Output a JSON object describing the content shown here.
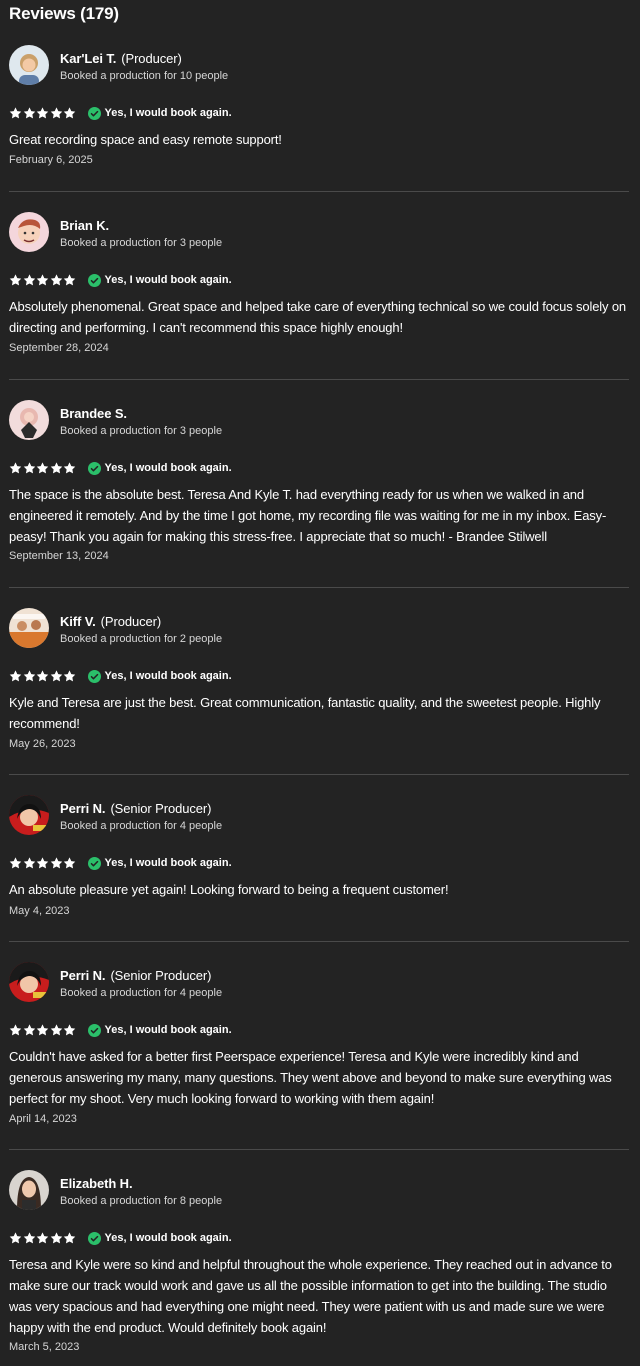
{
  "header": {
    "title": "Reviews (179)"
  },
  "icons": {
    "star": "star-icon",
    "check": "check-circle-icon"
  },
  "colors": {
    "background": "#232323",
    "check_green": "#2bbf6a",
    "star": "#ffffff"
  },
  "reviews": [
    {
      "name": "Kar'Lei T.",
      "role": "(Producer)",
      "booked": "Booked a production for 10 people",
      "rating": 5,
      "book_again": "Yes, I would book again.",
      "text": "Great recording space and easy remote support!",
      "date": "February 6, 2025"
    },
    {
      "name": "Brian K.",
      "role": "",
      "booked": "Booked a production for 3 people",
      "rating": 5,
      "book_again": "Yes, I would book again.",
      "text": "Absolutely phenomenal. Great space and helped take care of everything technical so we could focus solely on directing and performing. I can't recommend this space highly enough!",
      "date": "September 28, 2024"
    },
    {
      "name": "Brandee S.",
      "role": "",
      "booked": "Booked a production for 3 people",
      "rating": 5,
      "book_again": "Yes, I would book again.",
      "text": "The space is the absolute best. Teresa And Kyle T. had everything ready for us when we walked in and engineered it remotely. And by the time I got home, my recording file was waiting for me in my inbox. Easy-peasy! Thank you again for making this stress-free. I appreciate that so much! - Brandee Stilwell",
      "date": "September 13, 2024"
    },
    {
      "name": "Kiff V.",
      "role": "(Producer)",
      "booked": "Booked a production for 2 people",
      "rating": 5,
      "book_again": "Yes, I would book again.",
      "text": "Kyle and Teresa are just the best. Great communication, fantastic quality, and the sweetest people. Highly recommend!",
      "date": "May 26, 2023"
    },
    {
      "name": "Perri N.",
      "role": "(Senior Producer)",
      "booked": "Booked a production for 4 people",
      "rating": 5,
      "book_again": "Yes, I would book again.",
      "text": "An absolute pleasure yet again! Looking forward to being a frequent customer!",
      "date": "May 4, 2023"
    },
    {
      "name": "Perri N.",
      "role": "(Senior Producer)",
      "booked": "Booked a production for 4 people",
      "rating": 5,
      "book_again": "Yes, I would book again.",
      "text": "Couldn't have asked for a better first Peerspace experience! Teresa and Kyle were incredibly kind and generous answering my many, many questions. They went above and beyond to make sure everything was perfect for my shoot. Very much looking forward to working with them again!",
      "date": "April 14, 2023"
    },
    {
      "name": "Elizabeth H.",
      "role": "",
      "booked": "Booked a production for 8 people",
      "rating": 5,
      "book_again": "Yes, I would book again.",
      "text": "Teresa and Kyle were so kind and helpful throughout the whole experience. They reached out in advance to make sure our track would work and gave us all the possible information to get into the building. The studio was very spacious and had everything one might need. They were patient with us and made sure we were happy with the end product. Would definitely book again!",
      "date": "March 5, 2023"
    }
  ]
}
